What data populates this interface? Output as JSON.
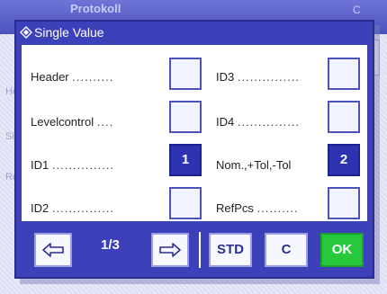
{
  "background": {
    "title": "Protokoll",
    "title_right": "C",
    "side_labels": [
      "He",
      "Sie",
      "Re"
    ]
  },
  "dialog": {
    "title": "Single Value",
    "icon": "scale-icon",
    "rows": [
      {
        "label": "Header",
        "dots": "..........",
        "value": ""
      },
      {
        "label": "Levelcontrol",
        "dots": "....",
        "value": ""
      },
      {
        "label": "ID1",
        "dots": "...............",
        "value": "1"
      },
      {
        "label": "ID2",
        "dots": "...............",
        "value": ""
      },
      {
        "label": "ID3",
        "dots": "...............",
        "value": ""
      },
      {
        "label": "ID4",
        "dots": "...............",
        "value": ""
      },
      {
        "label": "Nom.,+Tol,-Tol",
        "dots": "",
        "value": "2"
      },
      {
        "label": "RefPcs",
        "dots": "..........",
        "value": ""
      }
    ]
  },
  "footer": {
    "prev_icon": "arrow-left-icon",
    "next_icon": "arrow-right-icon",
    "page": "1/3",
    "std_label": "STD",
    "c_label": "C",
    "ok_label": "OK"
  },
  "colors": {
    "dialog_blue": "#3d41b9",
    "selected_value": "#2e33b2",
    "ok_green": "#28c83d"
  }
}
